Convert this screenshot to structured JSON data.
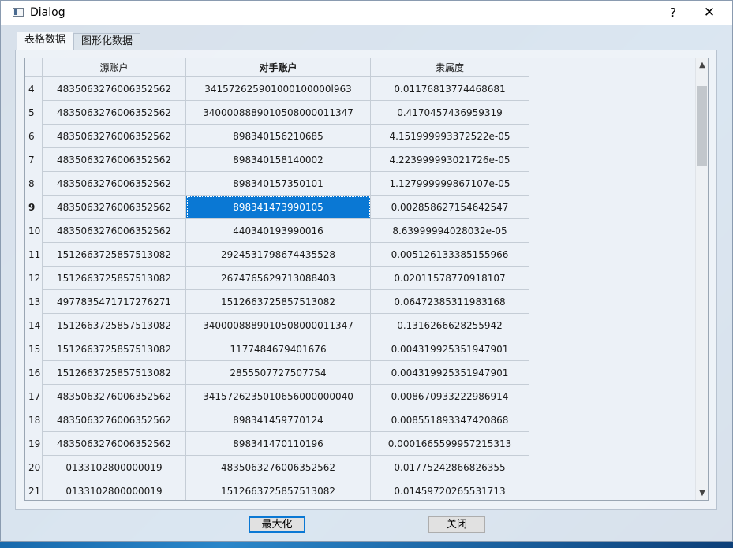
{
  "window": {
    "title": "Dialog",
    "help_label": "?",
    "close_label": "✕"
  },
  "tabs": [
    {
      "label": "表格数据",
      "active": true
    },
    {
      "label": "图形化数据",
      "active": false
    }
  ],
  "table": {
    "columns": [
      "源账户",
      "对手账户",
      "隶属度"
    ],
    "current_row": "9",
    "rows": [
      {
        "num": "4",
        "source": "4835063276006352562",
        "counterparty": "341572625901000100000l963",
        "membership": "0.01176813774468681"
      },
      {
        "num": "5",
        "source": "4835063276006352562",
        "counterparty": "3400008889010508000011347",
        "membership": "0.4170457436959319"
      },
      {
        "num": "6",
        "source": "4835063276006352562",
        "counterparty": "898340156210685",
        "membership": "4.151999993372522e-05"
      },
      {
        "num": "7",
        "source": "4835063276006352562",
        "counterparty": "898340158140002",
        "membership": "4.223999993021726e-05"
      },
      {
        "num": "8",
        "source": "4835063276006352562",
        "counterparty": "898340157350101",
        "membership": "1.127999999867107e-05"
      },
      {
        "num": "9",
        "source": "4835063276006352562",
        "counterparty": "898341473990105",
        "membership": "0.002858627154642547"
      },
      {
        "num": "10",
        "source": "4835063276006352562",
        "counterparty": "440340193990016",
        "membership": "8.63999994028032e-05"
      },
      {
        "num": "11",
        "source": "1512663725857513082",
        "counterparty": "2924531798674435528",
        "membership": "0.005126133385155966"
      },
      {
        "num": "12",
        "source": "1512663725857513082",
        "counterparty": "2674765629713088403",
        "membership": "0.02011578770918107"
      },
      {
        "num": "13",
        "source": "4977835471717276271",
        "counterparty": "1512663725857513082",
        "membership": "0.06472385311983168"
      },
      {
        "num": "14",
        "source": "1512663725857513082",
        "counterparty": "3400008889010508000011347",
        "membership": "0.1316266628255942"
      },
      {
        "num": "15",
        "source": "1512663725857513082",
        "counterparty": "1177484679401676",
        "membership": "0.004319925351947901"
      },
      {
        "num": "16",
        "source": "1512663725857513082",
        "counterparty": "2855507727507754",
        "membership": "0.004319925351947901"
      },
      {
        "num": "17",
        "source": "4835063276006352562",
        "counterparty": "3415726235010656000000040",
        "membership": "0.008670933222986914"
      },
      {
        "num": "18",
        "source": "4835063276006352562",
        "counterparty": "898341459770124",
        "membership": "0.008551893347420868"
      },
      {
        "num": "19",
        "source": "4835063276006352562",
        "counterparty": "898341470110196",
        "membership": "0.0001665599957215313"
      },
      {
        "num": "20",
        "source": "0133102800000019",
        "counterparty": "4835063276006352562",
        "membership": "0.01775242866826355"
      },
      {
        "num": "21",
        "source": "0133102800000019",
        "counterparty": "1512663725857513082",
        "membership": "0.01459720265531713"
      }
    ]
  },
  "scrollbar": {
    "up_icon": "▲",
    "down_icon": "▼"
  },
  "buttons": {
    "maximize_label": "最大化",
    "close_label": "关闭"
  }
}
